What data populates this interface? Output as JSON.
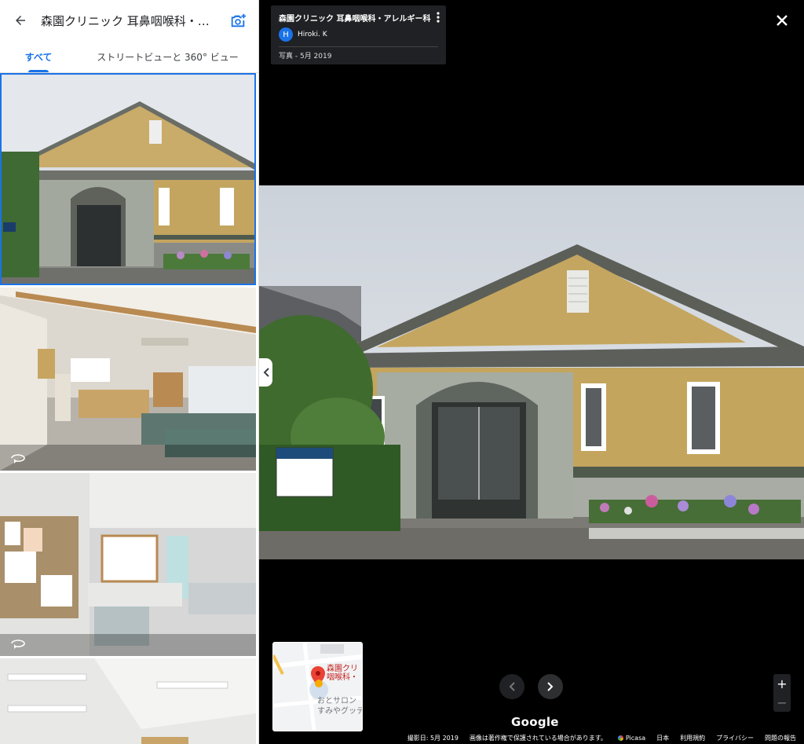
{
  "left_panel": {
    "title": "森園クリニック 耳鼻咽喉科・ア...",
    "tabs": [
      {
        "label": "すべて",
        "active": true
      },
      {
        "label": "ストリートビューと 360° ビュー",
        "active": false
      }
    ]
  },
  "info_card": {
    "title": "森園クリニック 耳鼻咽喉科・アレルギー科",
    "avatar_letter": "H",
    "author": "Hiroki. K",
    "meta": "写真 - 5月 2019"
  },
  "minimap": {
    "place_label": "森園クリ\n咽喉科・",
    "nearby_label": "おとサロン\nすみやグッデ"
  },
  "zoom": {
    "in": "+",
    "out": "−"
  },
  "brand": "Google",
  "footer": {
    "date": "撮影日: 5月 2019",
    "copyright": "画像は著作権で保護されている場合があります。",
    "picasa": "Picasa",
    "country": "日本",
    "terms": "利用規約",
    "privacy": "プライバシー",
    "report": "問題の報告"
  },
  "colors": {
    "accent": "#1a73e8",
    "card_bg": "#202124"
  },
  "icons": {
    "back": "arrow-left-icon",
    "camera": "add-photo-icon",
    "more": "more-vert-icon",
    "close": "close-icon",
    "rotate": "360-rotate-icon"
  }
}
